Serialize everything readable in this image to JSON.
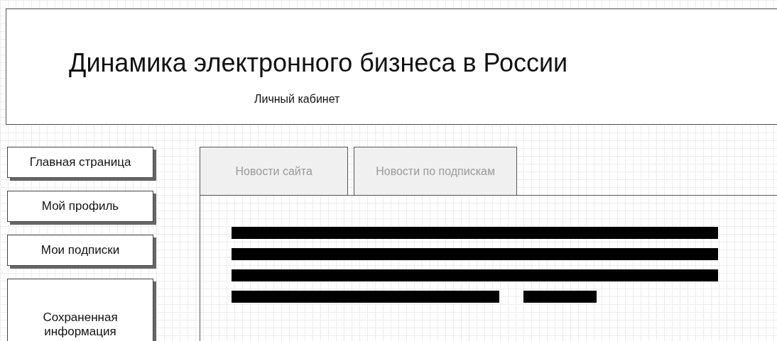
{
  "header": {
    "title": "Динамика электронного бизнеса в России",
    "subtitle": "Личный кабинет"
  },
  "sidebar": {
    "items": [
      {
        "label": "Главная страница"
      },
      {
        "label": "Мой профиль"
      },
      {
        "label": "Мои подписки"
      },
      {
        "label": "Сохраненная информация"
      }
    ]
  },
  "tabs": [
    {
      "label": "Новости сайта",
      "selected": false
    },
    {
      "label": "Новости по подпискам",
      "selected": false
    }
  ]
}
